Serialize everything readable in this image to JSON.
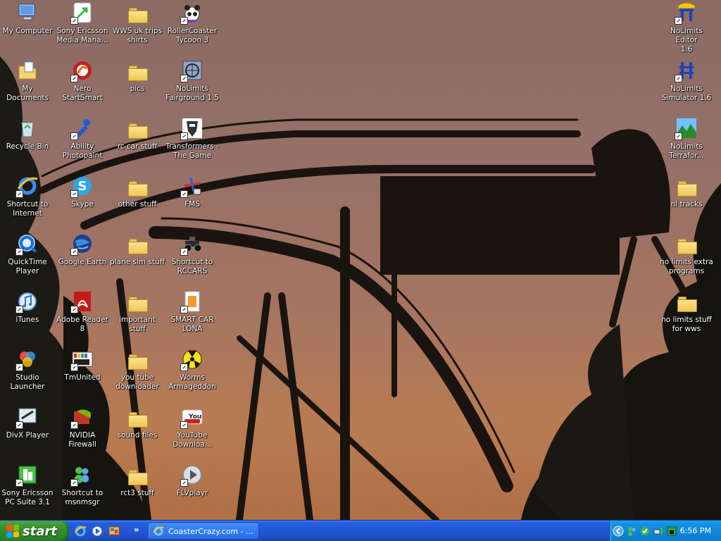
{
  "desktop": {
    "icons": [
      {
        "label": "My Computer",
        "icon": "my-computer-icon"
      },
      {
        "label": "My Documents",
        "icon": "my-documents-icon"
      },
      {
        "label": "Recycle Bin",
        "icon": "recycle-bin-icon"
      },
      {
        "label": "Shortcut to\nInternet",
        "icon": "internet-explorer-icon"
      },
      {
        "label": "QuickTime\nPlayer",
        "icon": "quicktime-icon"
      },
      {
        "label": "iTunes",
        "icon": "itunes-icon"
      },
      {
        "label": "Studio\nLauncher",
        "icon": "studio-launcher-icon"
      },
      {
        "label": "DivX Player",
        "icon": "divx-icon"
      },
      {
        "label": "Sony Ericsson\nPC Suite 3.1",
        "icon": "pc-suite-icon"
      },
      {
        "label": "Sony Ericsson\nMedia Mana...",
        "icon": "media-manager-icon"
      },
      {
        "label": "Nero\nStartSmart",
        "icon": "nero-icon"
      },
      {
        "label": "Ability\nPhotopaint",
        "icon": "photopaint-icon"
      },
      {
        "label": "Skype",
        "icon": "skype-icon"
      },
      {
        "label": "Google Earth",
        "icon": "google-earth-icon"
      },
      {
        "label": "Adobe Reader\n8",
        "icon": "adobe-reader-icon"
      },
      {
        "label": "TmUnited",
        "icon": "tmunited-icon"
      },
      {
        "label": "NVIDIA Firewall",
        "icon": "nvidia-firewall-icon"
      },
      {
        "label": "Shortcut to\nmsnmsgr",
        "icon": "msn-messenger-icon"
      },
      {
        "label": "WWS uk trips\nshirts",
        "icon": "folder-icon"
      },
      {
        "label": "pics",
        "icon": "folder-icon"
      },
      {
        "label": "rc car stuff",
        "icon": "folder-icon"
      },
      {
        "label": "other stuff",
        "icon": "folder-icon"
      },
      {
        "label": "plane sim stuff",
        "icon": "folder-icon"
      },
      {
        "label": "important stuff",
        "icon": "folder-icon"
      },
      {
        "label": "you tube\ndownloader",
        "icon": "folder-icon"
      },
      {
        "label": "sound files",
        "icon": "folder-icon"
      },
      {
        "label": "rct3 stuff",
        "icon": "folder-icon"
      },
      {
        "label": "RollerCoaster\nTycoon 3",
        "icon": "rollercoaster-tycoon-icon"
      },
      {
        "label": "NoLimits\nFairground 1.5",
        "icon": "nolimits-fairground-icon"
      },
      {
        "label": "Transformers -\nThe Game",
        "icon": "transformers-icon"
      },
      {
        "label": "FMS",
        "icon": "fms-icon"
      },
      {
        "label": "Shortcut to\nRCCARS",
        "icon": "rccars-icon"
      },
      {
        "label": "SMART CAR\nLONA",
        "icon": "smart-car-icon"
      },
      {
        "label": "Worms\nArmageddon",
        "icon": "worms-icon"
      },
      {
        "label": "YouTube\nDownloa...",
        "icon": "youtube-icon"
      },
      {
        "label": "FLVplayr",
        "icon": "flv-player-icon"
      },
      {
        "label": "NoLimits Editor\n1.6",
        "icon": "nolimits-editor-icon"
      },
      {
        "label": "NoLimits\nSimulator 1.6",
        "icon": "nolimits-simulator-icon"
      },
      {
        "label": "NoLimits\nTerrafor...",
        "icon": "nolimits-terraformer-icon"
      },
      {
        "label": "nl tracks",
        "icon": "folder-icon"
      },
      {
        "label": "no limits extra\nprograms",
        "icon": "folder-icon"
      },
      {
        "label": "no limits stuff\nfor wws",
        "icon": "folder-icon"
      }
    ]
  },
  "taskbar": {
    "start_label": "start",
    "quick_launch": [
      "internet-explorer-icon",
      "media-player-icon",
      "show-desktop-icon"
    ],
    "task_label": "CoasterCrazy.com - ...",
    "tray_icons": [
      "chevron-left-icon",
      "messenger-icon",
      "network-icon",
      "wireless-icon",
      "security-icon"
    ],
    "clock": "6:56 PM"
  }
}
